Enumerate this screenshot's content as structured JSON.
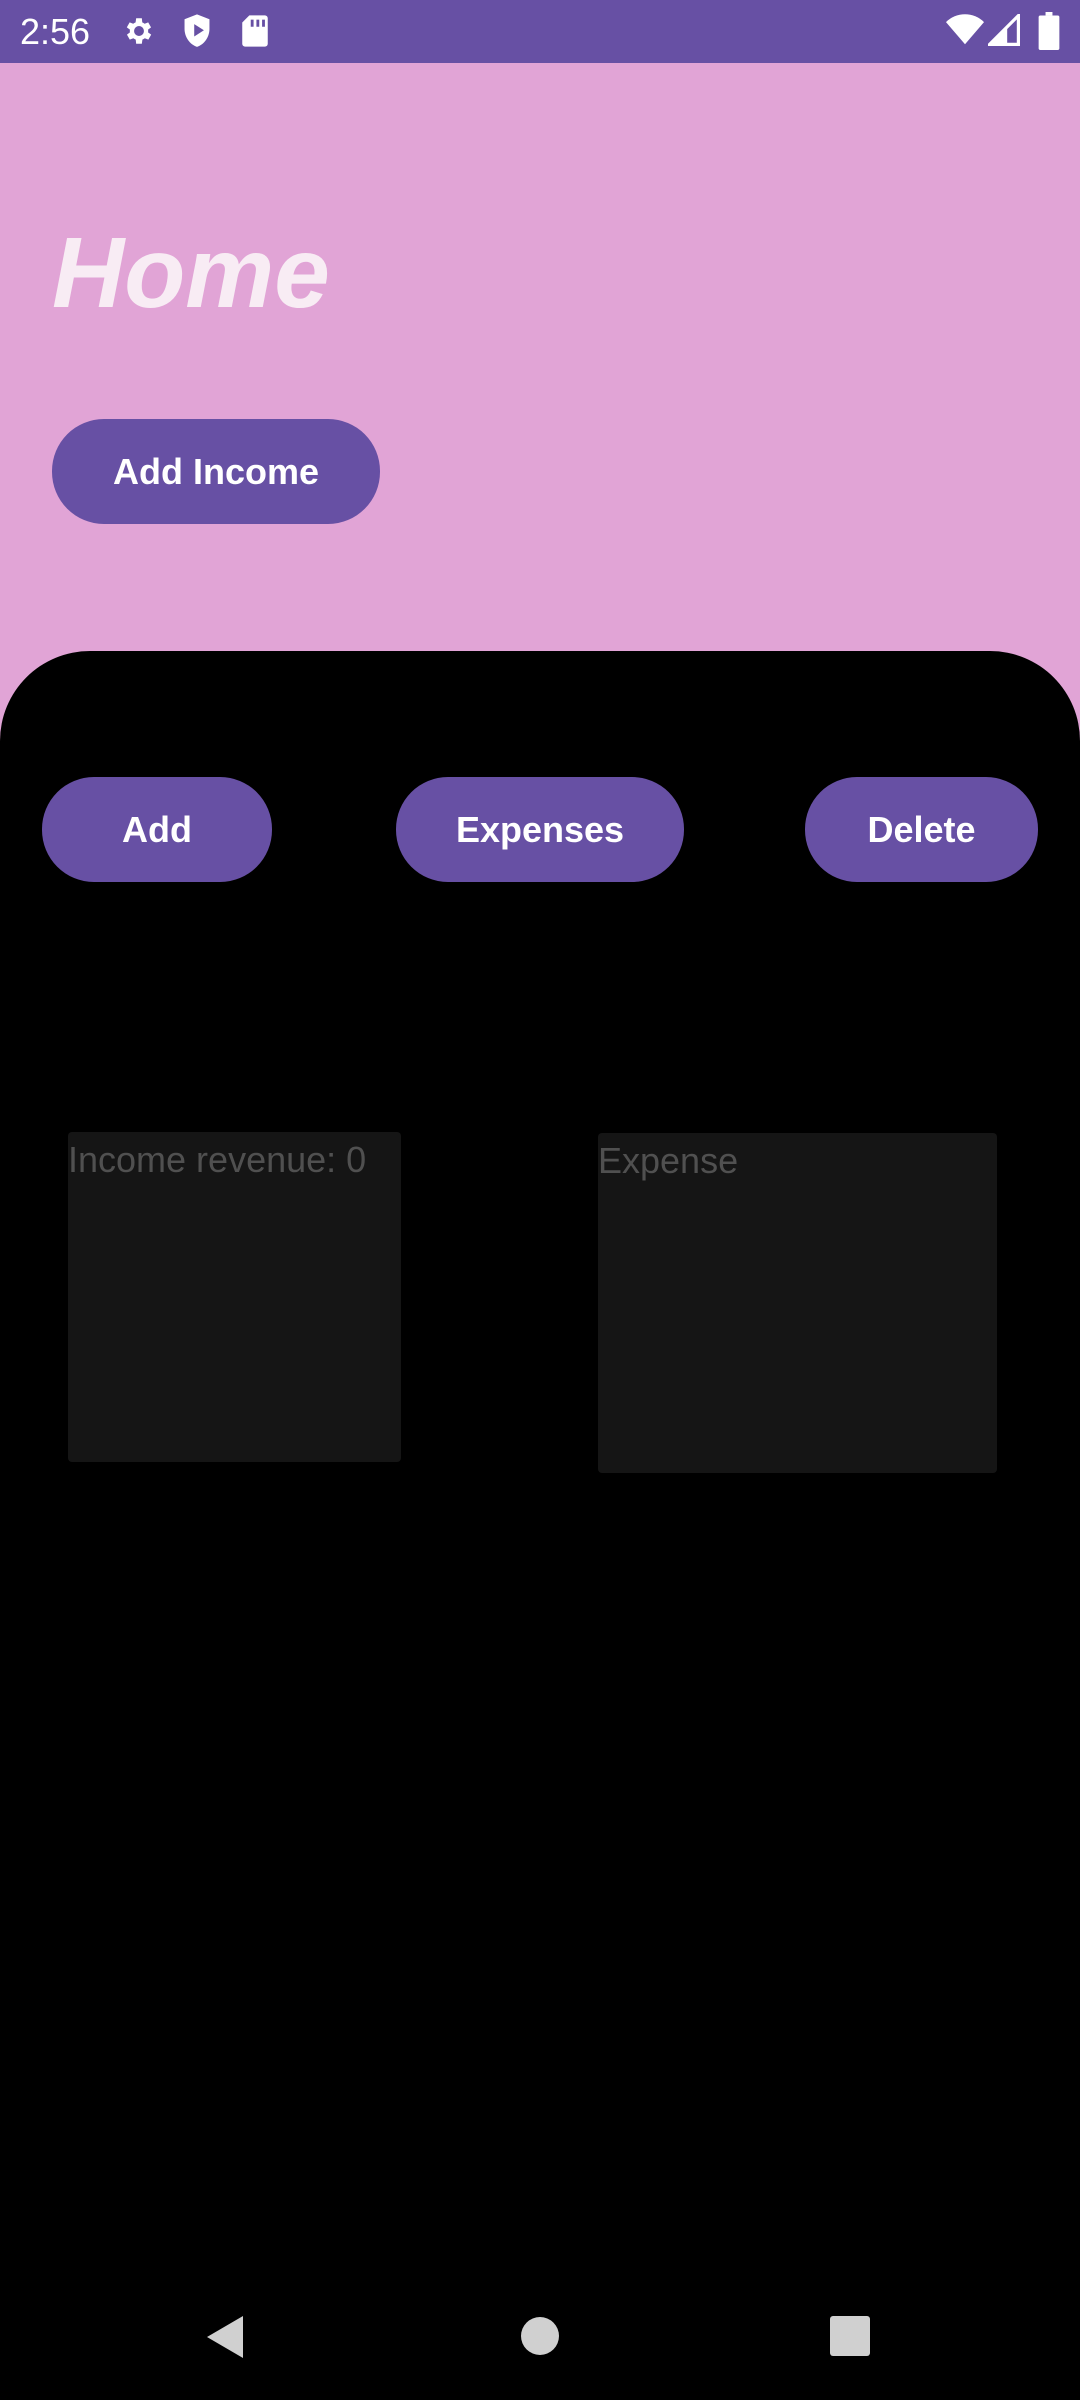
{
  "status_bar": {
    "time": "2:56",
    "left_icons": [
      "gear-icon",
      "shield-play-icon",
      "sd-card-icon"
    ],
    "right_icons": [
      "wifi-icon",
      "cell-signal-icon",
      "battery-icon"
    ]
  },
  "header": {
    "title": "Home",
    "add_income_label": "Add Income"
  },
  "panel": {
    "buttons": {
      "add_label": "Add",
      "expenses_label": "Expenses",
      "delete_label": "Delete"
    },
    "income_card": {
      "text": "Income revenue: 0"
    },
    "expense_card": {
      "text": "Expense"
    }
  },
  "nav_bar": {
    "icons": [
      "back-icon",
      "home-icon",
      "recents-icon"
    ]
  },
  "colors": {
    "status_bar": "#6750a4",
    "header_bg": "#e1a4d6",
    "button": "#6750a4",
    "panel_bg": "#000000",
    "card_bg": "#151515",
    "card_text": "#505050"
  }
}
